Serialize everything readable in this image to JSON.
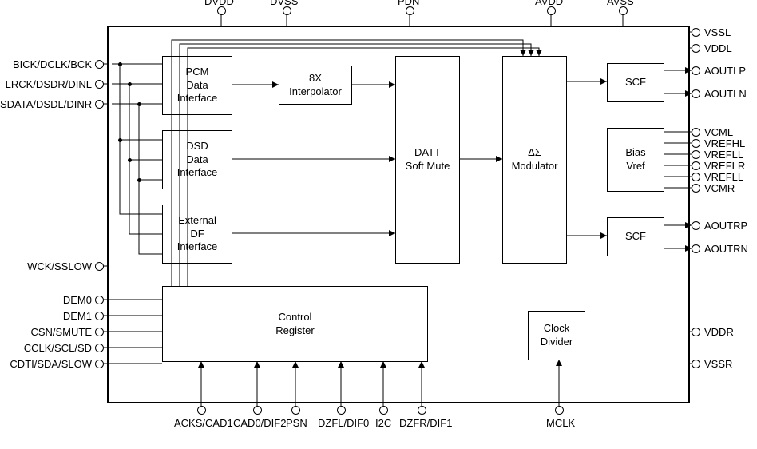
{
  "pins_top": [
    {
      "label": "DVDD"
    },
    {
      "label": "DVSS"
    },
    {
      "label": "PDN"
    },
    {
      "label": "AVDD"
    },
    {
      "label": "AVSS"
    }
  ],
  "pins_left_a": [
    {
      "label": "BICK/DCLK/BCK"
    },
    {
      "label": "LRCK/DSDR/DINL"
    },
    {
      "label": "SDATA/DSDL/DINR"
    }
  ],
  "pins_left_b": [
    {
      "label": "WCK/SSLOW"
    }
  ],
  "pins_left_c": [
    {
      "label": "DEM0"
    },
    {
      "label": "DEM1"
    },
    {
      "label": "CSN/SMUTE"
    },
    {
      "label": "CCLK/SCL/SD"
    },
    {
      "label": "CDTI/SDA/SLOW"
    }
  ],
  "pins_right_a": [
    {
      "label": "VSSL"
    },
    {
      "label": "VDDL"
    },
    {
      "label": "AOUTLP"
    },
    {
      "label": "AOUTLN"
    }
  ],
  "pins_right_b": [
    {
      "label": "VCML"
    },
    {
      "label": "VREFHL"
    },
    {
      "label": "VREFLL"
    },
    {
      "label": "VREFLR"
    },
    {
      "label": "VREFLL"
    },
    {
      "label": "VCMR"
    }
  ],
  "pins_right_c": [
    {
      "label": "AOUTRP"
    },
    {
      "label": "AOUTRN"
    }
  ],
  "pins_right_d": [
    {
      "label": "VDDR"
    },
    {
      "label": "VSSR"
    }
  ],
  "pins_bottom": [
    {
      "label": "ACKS/CAD1"
    },
    {
      "label": "CAD0/DIF2"
    },
    {
      "label": "PSN"
    },
    {
      "label": "DZFL/DIF0"
    },
    {
      "label": "I2C"
    },
    {
      "label": "DZFR/DIF1"
    },
    {
      "label": "MCLK"
    }
  ],
  "blocks": {
    "pcm": "PCM\nData\nInterface",
    "interp": "8X\nInterpolator",
    "dsd": "DSD\nData\nInterface",
    "ext": "External\nDF\nInterface",
    "datt": "DATT\nSoft Mute",
    "mod": "ΔΣ\nModulator",
    "scf1": "SCF",
    "scf2": "SCF",
    "bias": "Bias\nVref",
    "ctrl": "Control\nRegister",
    "clk": "Clock\nDivider"
  }
}
